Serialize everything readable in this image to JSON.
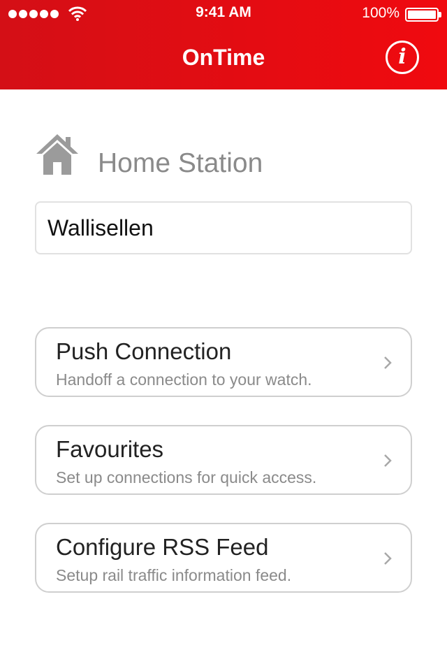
{
  "status_bar": {
    "time": "9:41 AM",
    "battery": "100%",
    "signal_icon": "signal-dots-icon",
    "wifi_icon": "wifi-icon",
    "battery_icon": "battery-icon"
  },
  "nav": {
    "title": "OnTime",
    "info_icon": "info-icon",
    "info_glyph": "i"
  },
  "home": {
    "icon": "home-icon",
    "label": "Home Station",
    "station": "Wallisellen"
  },
  "menu": [
    {
      "title": "Push Connection",
      "subtitle": "Handoff a connection to your watch."
    },
    {
      "title": "Favourites",
      "subtitle": "Set up connections for quick access."
    },
    {
      "title": "Configure RSS Feed",
      "subtitle": "Setup rail traffic information feed."
    }
  ],
  "colors": {
    "accent": "#e30a12",
    "muted_text": "#8a8a8a",
    "card_border": "#cfcfcf"
  }
}
